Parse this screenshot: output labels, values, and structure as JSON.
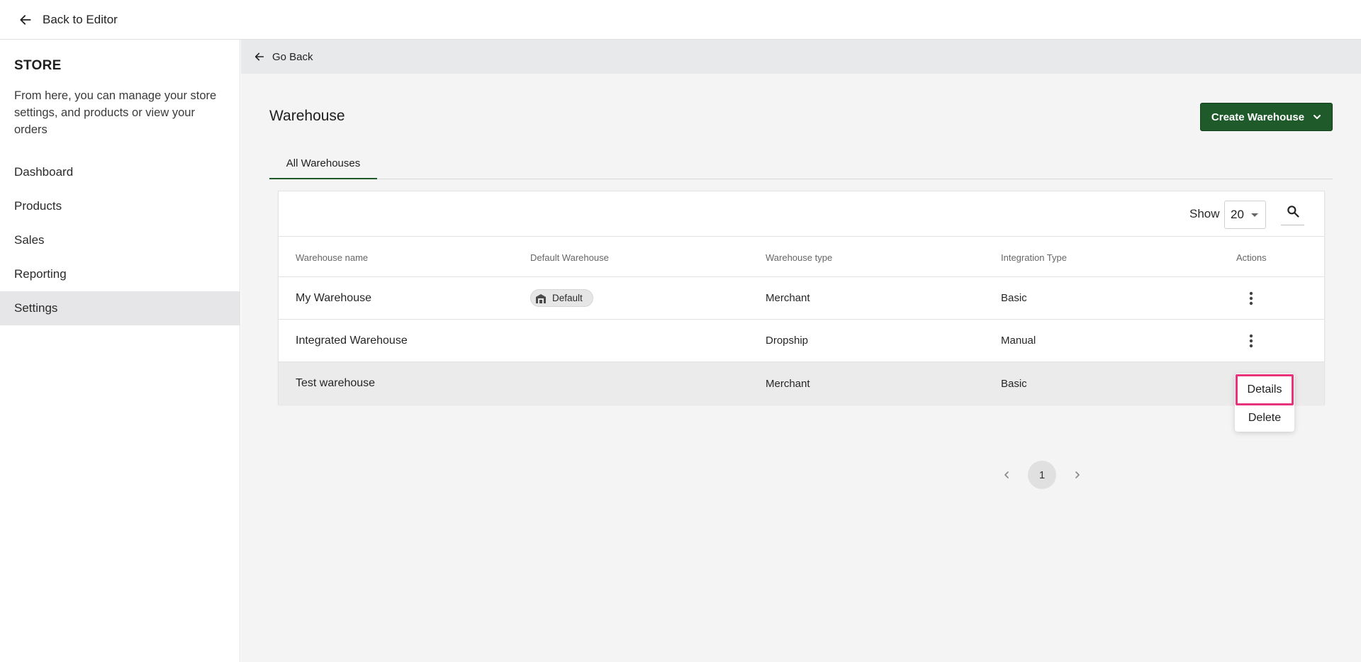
{
  "topbar": {
    "back_label": "Back to Editor"
  },
  "sidebar": {
    "title": "STORE",
    "description": "From here, you can manage your store settings, and products or view your orders",
    "items": [
      {
        "label": "Dashboard",
        "active": false
      },
      {
        "label": "Products",
        "active": false
      },
      {
        "label": "Sales",
        "active": false
      },
      {
        "label": "Reporting",
        "active": false
      },
      {
        "label": "Settings",
        "active": true
      }
    ]
  },
  "main": {
    "go_back_label": "Go Back",
    "title": "Warehouse",
    "create_button_label": "Create Warehouse",
    "tabs": [
      {
        "label": "All Warehouses",
        "active": true
      }
    ],
    "toolbar": {
      "show_label": "Show",
      "page_size": "20"
    },
    "table": {
      "columns": [
        "Warehouse name",
        "Default Warehouse",
        "Warehouse type",
        "Integration Type",
        "Actions"
      ],
      "rows": [
        {
          "name": "My Warehouse",
          "default_badge": "Default",
          "type": "Merchant",
          "integration": "Basic"
        },
        {
          "name": "Integrated Warehouse",
          "default_badge": "",
          "type": "Dropship",
          "integration": "Manual"
        },
        {
          "name": "Test warehouse",
          "default_badge": "",
          "type": "Merchant",
          "integration": "Basic"
        }
      ]
    },
    "action_menu": {
      "items": [
        "Details",
        "Delete"
      ],
      "highlighted": "Details"
    },
    "pagination": {
      "current_page": "1"
    }
  },
  "colors": {
    "primary_button": "#1f5a2a",
    "active_tab_underline": "#1f5a2a",
    "highlight_outline": "#e8327a",
    "main_background": "#f4f4f4",
    "sidebar_active": "#e6e6e8"
  },
  "icons": {
    "back": "arrow-left-icon",
    "create_dropdown": "chevron-down-icon",
    "search": "search-icon",
    "actions": "more-vertical-icon",
    "default_badge": "warehouse-icon",
    "pager_prev": "chevron-left-icon",
    "pager_next": "chevron-right-icon"
  }
}
